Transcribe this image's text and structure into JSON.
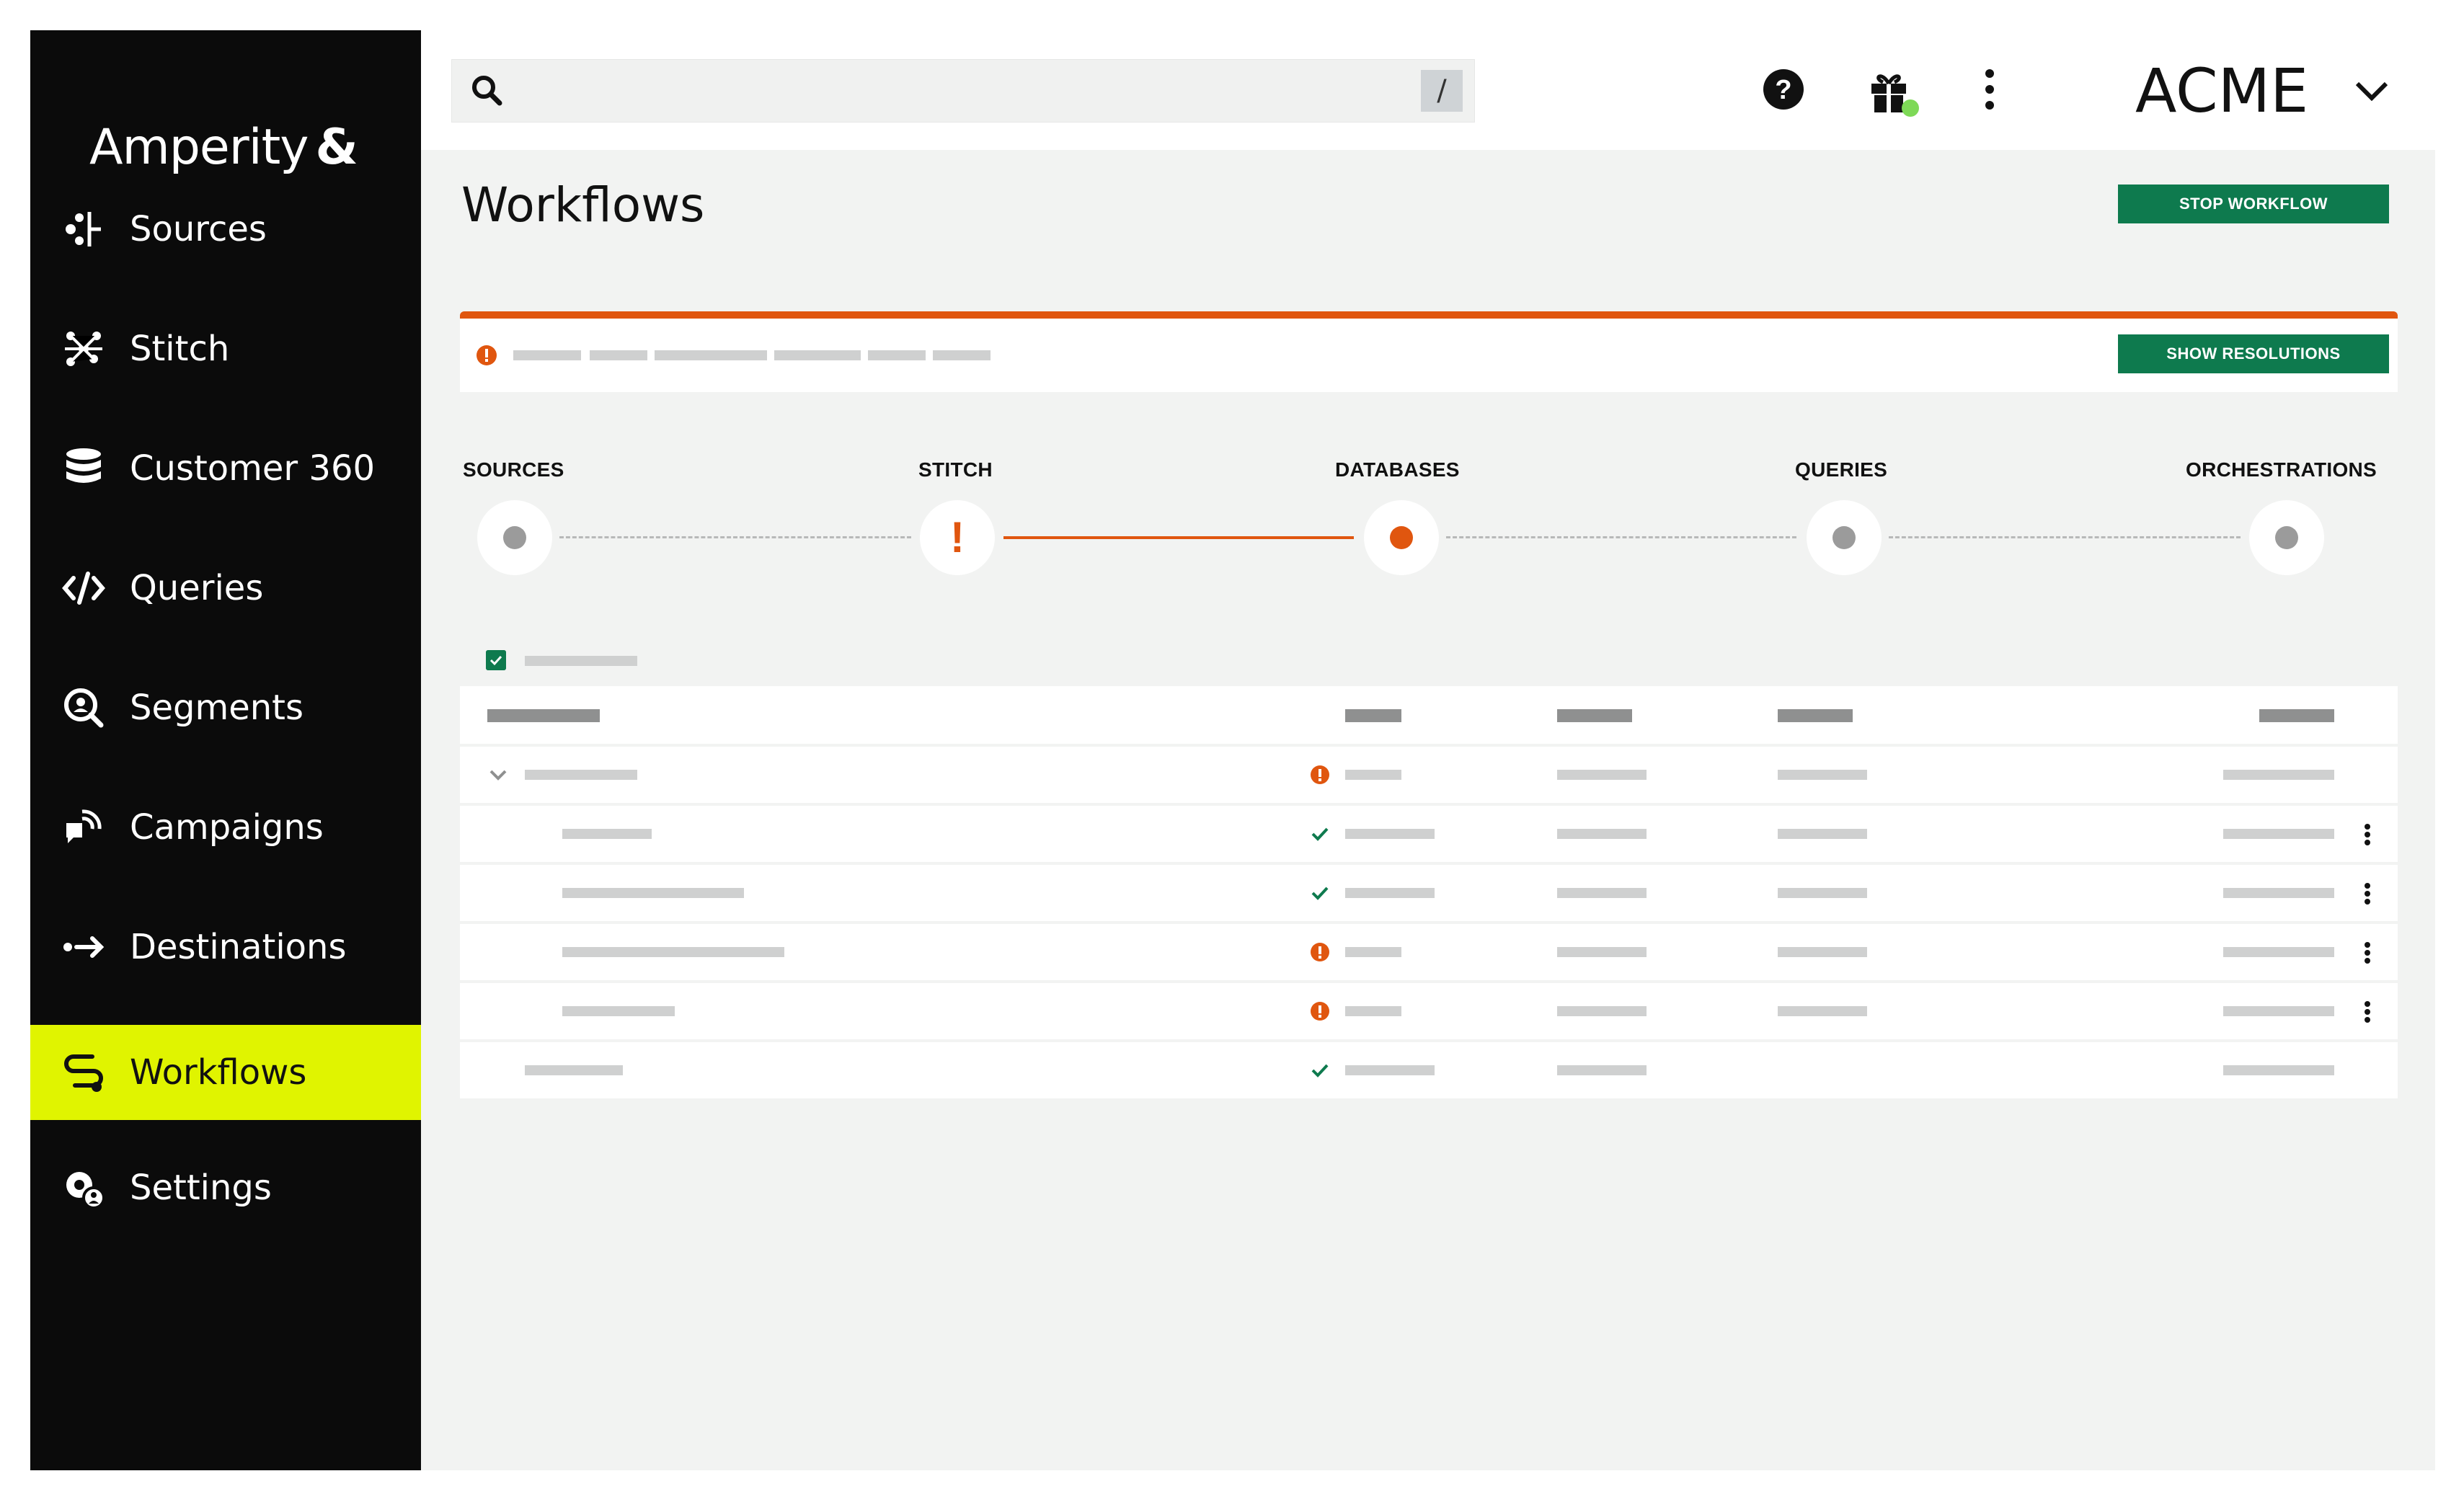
{
  "sidebar": {
    "logo_text": "Amperity",
    "logo_mark": "&",
    "items": [
      {
        "label": "Sources",
        "icon": "sources-icon",
        "active": false
      },
      {
        "label": "Stitch",
        "icon": "stitch-icon",
        "active": false
      },
      {
        "label": "Customer 360",
        "icon": "database-icon",
        "active": false
      },
      {
        "label": "Queries",
        "icon": "code-icon",
        "active": false
      },
      {
        "label": "Segments",
        "icon": "segments-icon",
        "active": false
      },
      {
        "label": "Campaigns",
        "icon": "campaigns-icon",
        "active": false
      },
      {
        "label": "Destinations",
        "icon": "destinations-icon",
        "active": false
      },
      {
        "label": "Workflows",
        "icon": "workflows-icon",
        "active": true
      },
      {
        "label": "Settings",
        "icon": "settings-icon",
        "active": false
      }
    ]
  },
  "topbar": {
    "search_shortcut": "/",
    "tenant_name": "ACME",
    "icons": [
      "help-icon",
      "gift-icon",
      "more-vertical-icon"
    ],
    "notification_dot_color": "#7ed957"
  },
  "page": {
    "title": "Workflows",
    "stop_button": "STOP WORKFLOW",
    "show_resolutions_button": "SHOW RESOLUTIONS"
  },
  "pipeline": {
    "stages": [
      {
        "label": "SOURCES",
        "state": "pending"
      },
      {
        "label": "STITCH",
        "state": "error"
      },
      {
        "label": "DATABASES",
        "state": "running"
      },
      {
        "label": "QUERIES",
        "state": "pending"
      },
      {
        "label": "ORCHESTRATIONS",
        "state": "pending"
      }
    ]
  },
  "table": {
    "rows": [
      {
        "kind": "group",
        "status": "error",
        "has_menu": false
      },
      {
        "kind": "child",
        "status": "success",
        "has_menu": true
      },
      {
        "kind": "child",
        "status": "success",
        "has_menu": true
      },
      {
        "kind": "child",
        "status": "error",
        "has_menu": true
      },
      {
        "kind": "child",
        "status": "error",
        "has_menu": true
      },
      {
        "kind": "item",
        "status": "success",
        "has_menu": false
      }
    ]
  },
  "colors": {
    "accent": "#e0f400",
    "primary_button": "#0e7a4e",
    "error": "#e0560f",
    "success": "#0e7a4e",
    "sidebar": "#0b0b0b"
  }
}
